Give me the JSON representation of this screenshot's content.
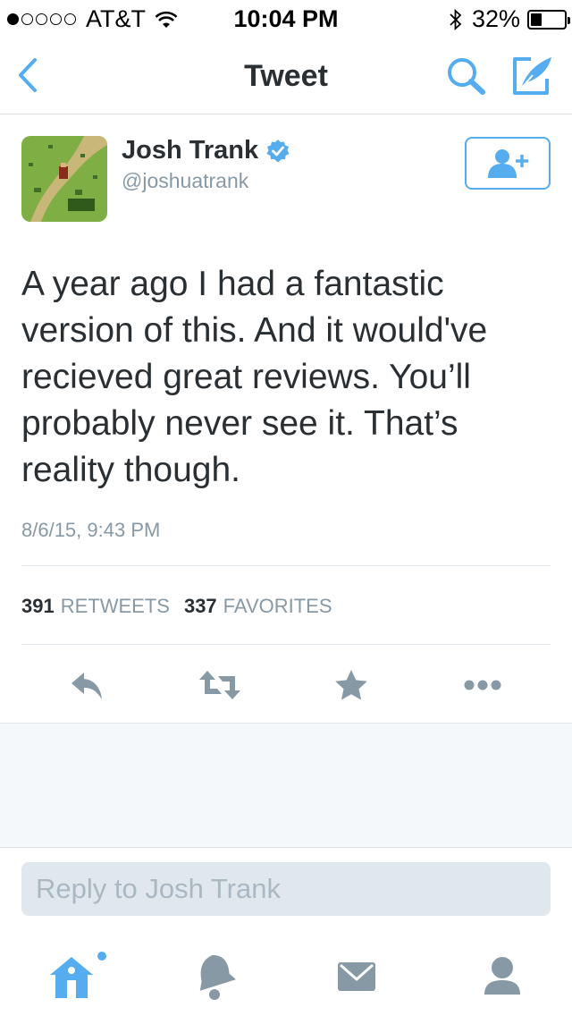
{
  "status_bar": {
    "carrier": "AT&T",
    "time": "10:04 PM",
    "battery_text": "32%",
    "battery_level": 0.32,
    "signal_bars_filled": 1,
    "signal_bars_total": 5
  },
  "nav": {
    "title": "Tweet"
  },
  "tweet": {
    "author_name": "Josh Trank",
    "author_handle": "@joshuatrank",
    "text": "A year ago I had a fantastic version of this. And it would've recieved great reviews. You’ll probably never see it. That’s reality though.",
    "timestamp": "8/6/15, 9:43 PM",
    "retweets_count": "391",
    "retweets_label": "RETWEETS",
    "favorites_count": "337",
    "favorites_label": "FAVORITES"
  },
  "reply": {
    "placeholder": "Reply to Josh Trank"
  },
  "icons": {
    "back": "chevron-left-icon",
    "search": "search-icon",
    "compose": "compose-icon",
    "verified": "verified-badge-icon",
    "follow": "add-user-icon",
    "reply": "reply-icon",
    "retweet": "retweet-icon",
    "favorite": "star-icon",
    "more": "more-icon",
    "home": "home-icon",
    "notifications": "bell-icon",
    "messages": "envelope-icon",
    "me": "person-icon"
  },
  "colors": {
    "accent": "#55acee",
    "text": "#292f33",
    "muted": "#8899a6",
    "icon_gray": "#8899a6"
  }
}
